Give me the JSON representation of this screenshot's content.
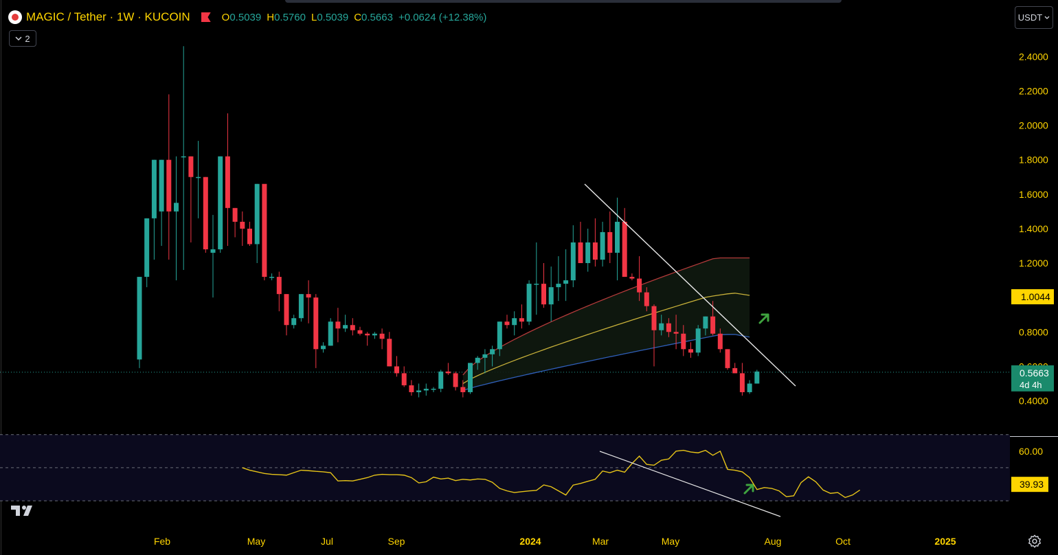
{
  "header": {
    "symbol_title": "MAGIC / Tether · 1W · KUCOIN",
    "ohlc": {
      "open_label": "O",
      "open": "0.5039",
      "high_label": "H",
      "high": "0.5760",
      "low_label": "L",
      "low": "0.5039",
      "close_label": "C",
      "close": "0.5663",
      "change": "+0.0624 (+12.38%)"
    },
    "indicators_toggle": "2",
    "currency": "USDT"
  },
  "price_axis": {
    "ticks": [
      "2.4000",
      "2.2000",
      "2.0000",
      "1.8000",
      "1.6000",
      "1.4000",
      "1.2000",
      "0.8000",
      "0.6000",
      "0.4000"
    ],
    "tick_values": [
      2.4,
      2.2,
      2.0,
      1.8,
      1.6,
      1.4,
      1.2,
      0.8,
      0.6,
      0.4
    ],
    "marker_label": "1.0044",
    "marker_value": 1.0044,
    "last_price": "0.5663",
    "last_value": 0.5663,
    "countdown": "4d 4h"
  },
  "rsi_axis": {
    "tick": "60.00",
    "tick_value": 60,
    "current": "39.93",
    "current_value": 39.93
  },
  "time_axis": {
    "labels": [
      "Feb",
      "May",
      "Jul",
      "Sep",
      "2024",
      "Mar",
      "May",
      "Aug",
      "Oct",
      "2025"
    ],
    "bold": [
      false,
      false,
      false,
      false,
      true,
      false,
      false,
      false,
      false,
      true
    ]
  },
  "colors": {
    "up": "#26a69a",
    "down": "#f23645",
    "axis_text": "#ffd500",
    "rsi_line": "#e8c518",
    "band_red": "#b33a3a",
    "band_yellow": "#c9b23a",
    "band_blue": "#2f5eb8",
    "arrow": "#3fa33f",
    "last_price_bg": "#1a8a6c",
    "marker_bg": "#ffd500"
  },
  "icons": [
    "magic-symbol-icon",
    "flag-icon",
    "chevron-down-icon",
    "tradingview-logo-icon",
    "gear-icon",
    "arrow-up-right-icon"
  ],
  "chart_data": [
    {
      "type": "candlestick",
      "title": "MAGIC / Tether · 1W · KUCOIN",
      "ylim": [
        0.34,
        2.6
      ],
      "candles": [
        [
          0.64,
          1.12,
          0.59,
          1.12
        ],
        [
          1.12,
          1.46,
          1.06,
          1.46
        ],
        [
          1.46,
          1.8,
          1.22,
          1.8
        ],
        [
          1.5,
          1.8,
          1.3,
          1.8
        ],
        [
          1.8,
          2.18,
          1.22,
          1.5
        ],
        [
          1.5,
          1.82,
          1.1,
          1.55
        ],
        [
          1.82,
          2.46,
          1.16,
          1.82
        ],
        [
          1.82,
          1.82,
          1.32,
          1.7
        ],
        [
          1.7,
          1.91,
          1.46,
          1.7
        ],
        [
          1.7,
          1.7,
          1.26,
          1.28
        ],
        [
          1.26,
          1.48,
          1.0,
          1.28
        ],
        [
          1.28,
          1.82,
          1.26,
          1.82
        ],
        [
          1.82,
          2.07,
          1.3,
          1.52
        ],
        [
          1.52,
          1.52,
          1.35,
          1.44
        ],
        [
          1.44,
          1.5,
          1.3,
          1.4
        ],
        [
          1.4,
          1.44,
          1.3,
          1.31
        ],
        [
          1.31,
          1.66,
          1.2,
          1.66
        ],
        [
          1.66,
          1.62,
          1.1,
          1.12
        ],
        [
          1.12,
          1.14,
          1.1,
          1.12
        ],
        [
          1.12,
          1.15,
          0.92,
          1.02
        ],
        [
          1.02,
          1.02,
          0.78,
          0.84
        ],
        [
          0.84,
          0.9,
          0.82,
          0.88
        ],
        [
          0.88,
          1.02,
          0.86,
          1.02
        ],
        [
          1.02,
          1.1,
          0.85,
          1.0
        ],
        [
          1.0,
          1.02,
          0.59,
          0.7
        ],
        [
          0.7,
          0.74,
          0.68,
          0.72
        ],
        [
          0.72,
          0.88,
          0.72,
          0.86
        ],
        [
          0.86,
          0.94,
          0.74,
          0.82
        ],
        [
          0.82,
          0.9,
          0.8,
          0.84
        ],
        [
          0.84,
          0.88,
          0.78,
          0.81
        ],
        [
          0.81,
          0.83,
          0.78,
          0.79
        ],
        [
          0.79,
          0.8,
          0.72,
          0.78
        ],
        [
          0.78,
          0.8,
          0.76,
          0.79
        ],
        [
          0.79,
          0.82,
          0.7,
          0.76
        ],
        [
          0.76,
          0.8,
          0.6,
          0.6
        ],
        [
          0.6,
          0.66,
          0.54,
          0.56
        ],
        [
          0.56,
          0.6,
          0.48,
          0.49
        ],
        [
          0.49,
          0.52,
          0.43,
          0.45
        ],
        [
          0.45,
          0.5,
          0.42,
          0.46
        ],
        [
          0.46,
          0.5,
          0.43,
          0.47
        ],
        [
          0.47,
          0.48,
          0.45,
          0.47
        ],
        [
          0.47,
          0.58,
          0.45,
          0.57
        ],
        [
          0.57,
          0.62,
          0.55,
          0.56
        ],
        [
          0.56,
          0.57,
          0.46,
          0.48
        ],
        [
          0.48,
          0.52,
          0.42,
          0.45
        ],
        [
          0.45,
          0.62,
          0.44,
          0.62
        ],
        [
          0.62,
          0.66,
          0.58,
          0.65
        ],
        [
          0.65,
          0.7,
          0.56,
          0.67
        ],
        [
          0.67,
          0.72,
          0.6,
          0.7
        ],
        [
          0.7,
          0.86,
          0.66,
          0.86
        ],
        [
          0.86,
          0.9,
          0.82,
          0.84
        ],
        [
          0.84,
          0.92,
          0.78,
          0.88
        ],
        [
          0.88,
          0.96,
          0.82,
          0.86
        ],
        [
          0.86,
          1.1,
          0.84,
          1.08
        ],
        [
          1.08,
          1.32,
          0.9,
          1.08
        ],
        [
          1.08,
          1.2,
          0.94,
          0.96
        ],
        [
          0.96,
          1.18,
          0.86,
          1.06
        ],
        [
          1.06,
          1.24,
          0.98,
          1.08
        ],
        [
          1.08,
          1.28,
          0.98,
          1.1
        ],
        [
          1.1,
          1.42,
          1.06,
          1.32
        ],
        [
          1.32,
          1.44,
          1.22,
          1.2
        ],
        [
          1.2,
          1.4,
          1.15,
          1.32
        ],
        [
          1.32,
          1.46,
          1.18,
          1.22
        ],
        [
          1.22,
          1.44,
          1.18,
          1.38
        ],
        [
          1.38,
          1.5,
          1.2,
          1.26
        ],
        [
          1.26,
          1.58,
          1.1,
          1.44
        ],
        [
          1.44,
          1.52,
          1.12,
          1.12
        ],
        [
          1.12,
          1.14,
          1.1,
          1.11
        ],
        [
          1.11,
          1.24,
          0.98,
          1.03
        ],
        [
          1.03,
          1.06,
          0.92,
          0.95
        ],
        [
          0.95,
          0.96,
          0.6,
          0.81
        ],
        [
          0.81,
          0.9,
          0.78,
          0.85
        ],
        [
          0.85,
          0.88,
          0.77,
          0.8
        ],
        [
          0.8,
          0.9,
          0.7,
          0.79
        ],
        [
          0.79,
          0.84,
          0.66,
          0.7
        ],
        [
          0.7,
          0.74,
          0.65,
          0.68
        ],
        [
          0.68,
          0.84,
          0.66,
          0.82
        ],
        [
          0.82,
          0.89,
          0.78,
          0.89
        ],
        [
          0.89,
          0.98,
          0.78,
          0.79
        ],
        [
          0.79,
          0.82,
          0.68,
          0.7
        ],
        [
          0.7,
          0.7,
          0.58,
          0.59
        ],
        [
          0.59,
          0.62,
          0.56,
          0.56
        ],
        [
          0.56,
          0.62,
          0.43,
          0.45
        ],
        [
          0.45,
          0.52,
          0.44,
          0.5
        ],
        [
          0.5,
          0.58,
          0.5,
          0.57
        ]
      ]
    },
    {
      "type": "line",
      "title": "",
      "ylim": [
        18,
        72
      ],
      "series": [
        {
          "values": [
            50.0,
            48.5,
            47.5,
            46.5,
            46.0,
            45.8,
            45.5,
            47.0,
            48.5,
            48.2,
            47.8,
            47.5,
            47.0,
            42.0,
            42.2,
            42.0,
            43.0,
            44.0,
            45.5,
            46.0,
            45.8,
            45.8,
            45.5,
            44.0,
            40.8,
            41.5,
            44.3,
            43.2,
            43.7,
            42.2,
            43.0,
            42.6,
            43.2,
            43.0,
            41.2,
            37.5,
            36.0,
            35.0,
            35.5,
            36.0,
            36.3,
            39.6,
            38.5,
            36.0,
            33.5,
            39.5,
            40.5,
            41.8,
            43.0,
            48.0,
            47.0,
            48.5,
            47.3,
            52.5,
            57.0,
            52.0,
            51.5,
            54.5,
            55.3,
            60.0,
            60.5,
            59.5,
            59.0,
            60.5,
            57.5,
            60.0,
            49.0,
            48.5,
            47.5,
            44.0,
            36.8,
            38.0,
            37.5,
            36.0,
            32.5,
            33.0,
            41.0,
            44.5,
            41.5,
            36.5,
            34.5,
            35.0,
            32.0,
            33.5,
            36.5
          ]
        }
      ]
    }
  ]
}
